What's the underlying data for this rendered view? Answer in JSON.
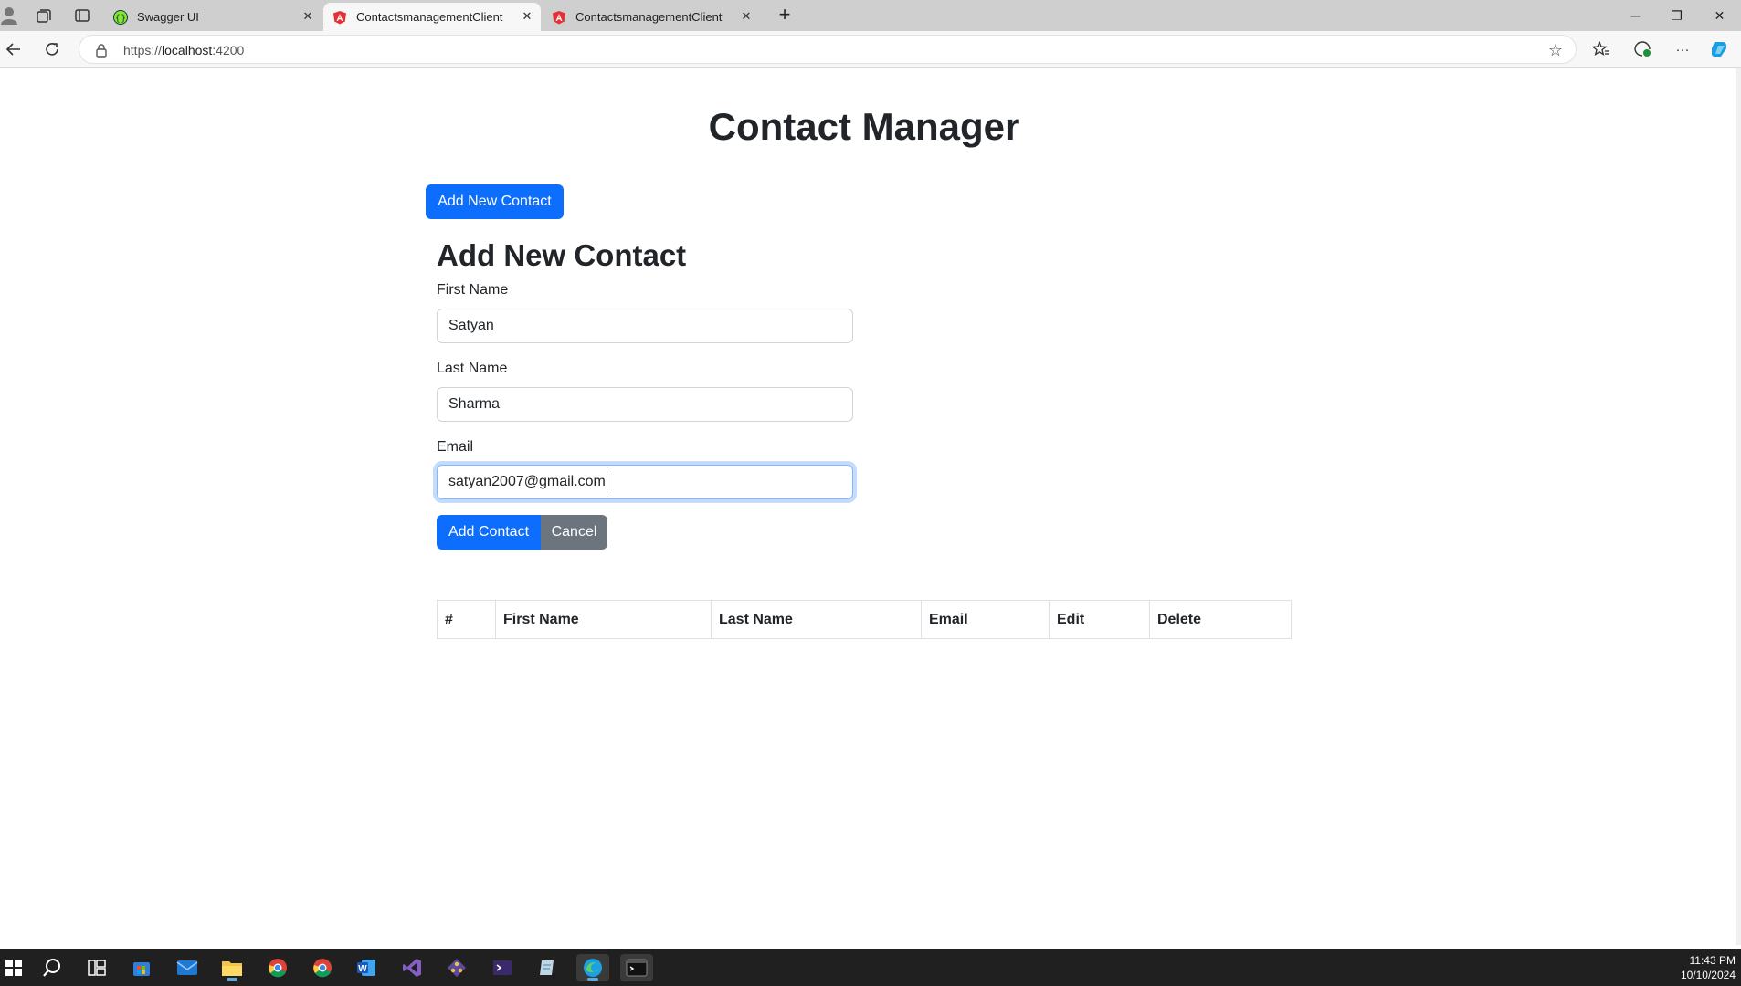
{
  "browser": {
    "tabs": [
      {
        "title": "Swagger UI",
        "icon": "swagger-icon"
      },
      {
        "title": "ContactsmanagementClient",
        "icon": "angular-icon"
      },
      {
        "title": "ContactsmanagementClient",
        "icon": "angular-icon"
      }
    ],
    "active_tab": 1,
    "url_prefix": "https://",
    "url_host": "localhost",
    "url_port": ":4200"
  },
  "page": {
    "title": "Contact Manager",
    "add_new_contact_button": "Add New Contact",
    "form": {
      "heading": "Add New Contact",
      "first_name_label": "First Name",
      "first_name_value": "Satyan",
      "last_name_label": "Last Name",
      "last_name_value": "Sharma",
      "email_label": "Email",
      "email_value": "satyan2007@gmail.com",
      "submit_label": "Add Contact",
      "cancel_label": "Cancel"
    },
    "table": {
      "headers": [
        "#",
        "First Name",
        "Last Name",
        "Email",
        "Edit",
        "Delete"
      ]
    }
  },
  "taskbar": {
    "time": "11:43 PM",
    "date": "10/10/2024"
  },
  "colors": {
    "primary": "#0d6efd",
    "secondary": "#6c757d",
    "taskbar": "#202020"
  }
}
